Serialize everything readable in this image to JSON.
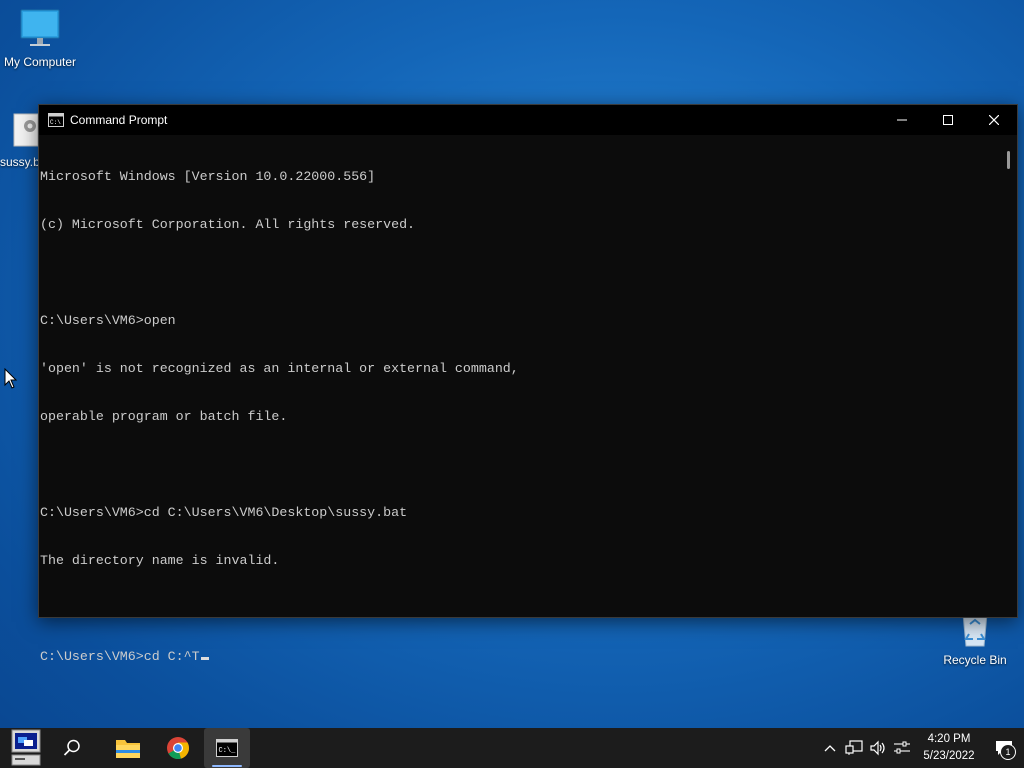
{
  "desktop": {
    "icons": [
      {
        "label": "My Computer"
      },
      {
        "label": "sussy.bat"
      },
      {
        "label": "Recycle Bin"
      }
    ]
  },
  "window": {
    "title": "Command Prompt",
    "console_lines": [
      "Microsoft Windows [Version 10.0.22000.556]",
      "(c) Microsoft Corporation. All rights reserved.",
      "",
      "C:\\Users\\VM6>open",
      "'open' is not recognized as an internal or external command,",
      "operable program or batch file.",
      "",
      "C:\\Users\\VM6>cd C:\\Users\\VM6\\Desktop\\sussy.bat",
      "The directory name is invalid.",
      "",
      "C:\\Users\\VM6>cd C:^T"
    ]
  },
  "taskbar": {
    "clock_time": "4:20 PM",
    "clock_date": "5/23/2022",
    "notification_count": "1"
  },
  "colors": {
    "console_bg": "#0c0c0c",
    "console_fg": "#cccccc",
    "taskbar_bg": "#1c1c1c",
    "desktop_bg": "#1466b8"
  }
}
